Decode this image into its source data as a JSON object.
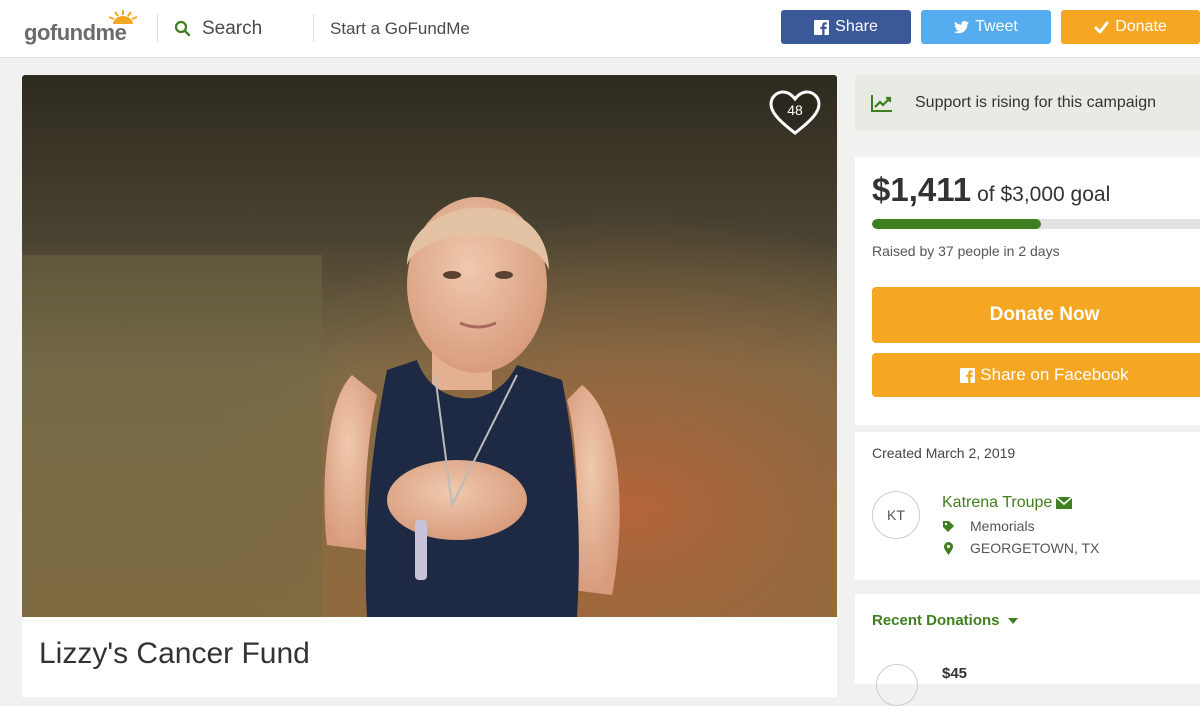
{
  "header": {
    "logo_text_a": "gofund",
    "logo_text_b": "me",
    "search_label": "Search",
    "start_label": "Start a GoFundMe",
    "share_label": "Share",
    "tweet_label": "Tweet",
    "donate_label": "Donate"
  },
  "campaign": {
    "likes": "48",
    "title": "Lizzy's Cancer Fund"
  },
  "sidebar": {
    "rising": "Support is rising for this campaign",
    "raised_amount": "$1,411",
    "goal_text": "of $3,000 goal",
    "progress": 0.47,
    "raised_by": "Raised by 37 people in 2 days",
    "donate_now": "Donate Now",
    "share_facebook": "Share on Facebook",
    "created": "Created March 2, 2019",
    "organizer_initials": "KT",
    "organizer_name": "Katrena Troupe",
    "category": "Memorials",
    "location": "GEORGETOWN, TX",
    "recent_donations": "Recent Donations",
    "first_donation": "$45"
  },
  "colors": {
    "brand_green": "#3f7f1f",
    "donate_orange": "#f5a623",
    "facebook_blue": "#3b5998",
    "twitter_blue": "#55acee"
  },
  "icons": [
    "search-icon",
    "facebook-icon",
    "twitter-icon",
    "check-icon",
    "heart-icon",
    "trend-up-icon",
    "mail-icon",
    "tag-icon",
    "map-pin-icon",
    "caret-down-icon"
  ]
}
